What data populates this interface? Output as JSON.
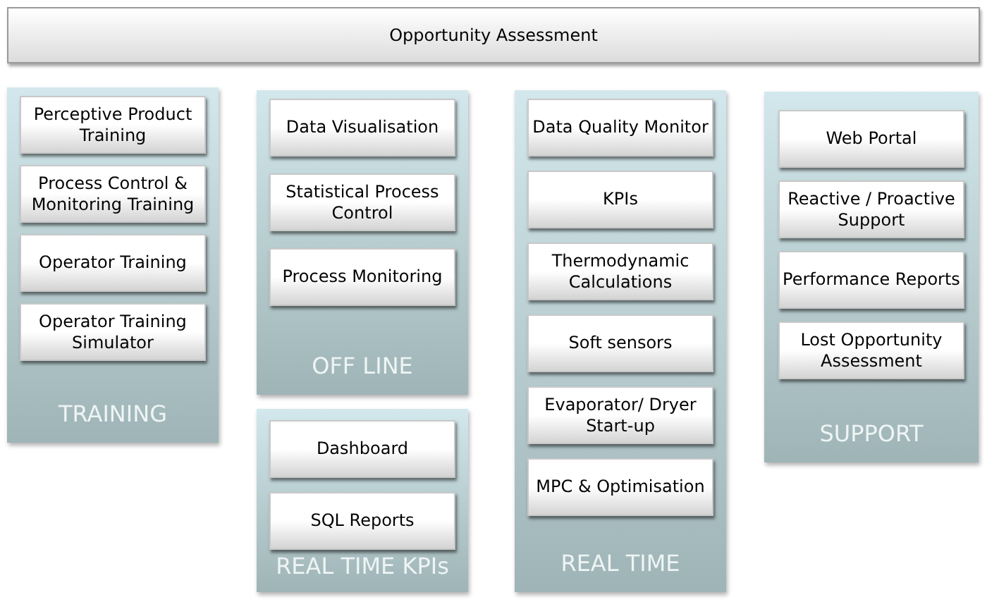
{
  "header": {
    "title": "Opportunity Assessment"
  },
  "columns": [
    [
      {
        "title": "TRAINING",
        "items": [
          "Perceptive Product Training",
          "Process Control & Monitoring Training",
          "Operator Training",
          "Operator Training Simulator"
        ]
      }
    ],
    [
      {
        "title": "OFF LINE",
        "items": [
          "Data Visualisation",
          "Statistical Process Control",
          "Process Monitoring"
        ]
      },
      {
        "title": "REAL TIME KPIs",
        "items": [
          "Dashboard",
          "SQL Reports"
        ]
      }
    ],
    [
      {
        "title": "REAL TIME",
        "items": [
          "Data Quality Monitor",
          "KPIs",
          "Thermodynamic Calculations",
          "Soft sensors",
          "Evaporator/ Dryer Start-up",
          "MPC & Optimisation"
        ]
      }
    ],
    [
      {
        "title": "SUPPORT",
        "items": [
          "Web Portal",
          "Reactive / Proactive Support",
          "Performance Reports",
          "Lost Opportunity Assessment"
        ]
      }
    ]
  ]
}
